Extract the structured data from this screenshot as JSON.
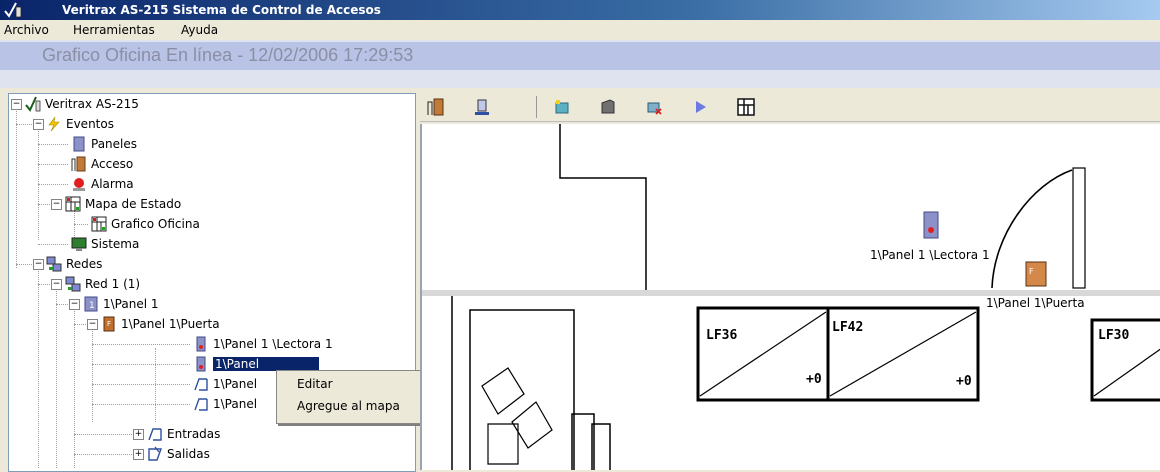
{
  "window": {
    "title": "Veritrax AS-215 Sistema de Control de Accesos"
  },
  "menu": {
    "items": [
      "Archivo",
      "Herramientas",
      "Ayuda"
    ]
  },
  "status": {
    "heading": "Grafico Oficina En línea - 12/02/2006 17:29:53"
  },
  "tree": {
    "nodes": [
      {
        "label": "Veritrax AS-215"
      },
      {
        "label": "Eventos"
      },
      {
        "label": "Paneles"
      },
      {
        "label": "Acceso"
      },
      {
        "label": "Alarma"
      },
      {
        "label": "Mapa de Estado"
      },
      {
        "label": "Grafico Oficina"
      },
      {
        "label": "Sistema"
      },
      {
        "label": "Redes"
      },
      {
        "label": "Red  1 (1)"
      },
      {
        "label": "1\\Panel  1"
      },
      {
        "label": "1\\Panel  1\\Puerta"
      },
      {
        "label": "1\\Panel 1 \\Lectora 1"
      },
      {
        "label": "1\\Panel"
      },
      {
        "label": "1\\Panel"
      },
      {
        "label": "1\\Panel"
      },
      {
        "label": "Entradas"
      },
      {
        "label": "Salidas"
      }
    ]
  },
  "context_menu": {
    "items": [
      "Editar",
      "Agregue al mapa"
    ]
  },
  "map": {
    "lectora_label": "1\\Panel  1 \\Lectora  1",
    "puerta_label": "1\\Panel  1\\Puerta",
    "lf36": "LF36",
    "lf42": "LF42",
    "lf30": "LF30",
    "d1": "+0",
    "d2": "+0"
  },
  "colors": {
    "titlebar": "#0a246a",
    "selection": "#0a246a",
    "statusbar": "#b9c3e6"
  }
}
